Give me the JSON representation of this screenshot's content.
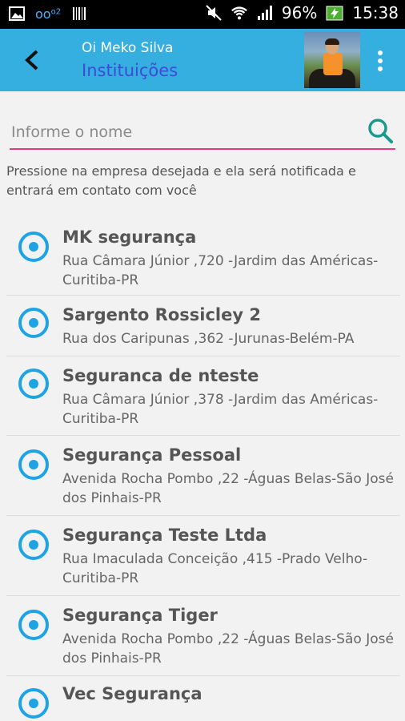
{
  "status_bar": {
    "battery": "96%",
    "time": "15:38",
    "carrier_label": "o2"
  },
  "app_bar": {
    "greeting": "Oi Meko Silva",
    "title": "Instituições"
  },
  "search": {
    "placeholder": "Informe o nome",
    "value": ""
  },
  "hint": "Pressione na empresa desejada e ela será notificada e entrará em contato com você",
  "companies": [
    {
      "name": "MK segurança",
      "address": "Rua Câmara Júnior ,720 -Jardim das Américas-Curitiba-PR"
    },
    {
      "name": "Sargento Rossicley 2",
      "address": "Rua dos Caripunas ,362 -Jurunas-Belém-PA"
    },
    {
      "name": "Seguranca de nteste",
      "address": "Rua Câmara Júnior ,378 -Jardim das Américas-Curitiba-PR"
    },
    {
      "name": "Segurança Pessoal",
      "address": "Avenida Rocha Pombo ,22 -Águas Belas-São José dos Pinhais-PR"
    },
    {
      "name": "Segurança Teste Ltda",
      "address": "Rua Imaculada Conceição ,415 -Prado Velho-Curitiba-PR"
    },
    {
      "name": "Segurança Tiger",
      "address": "Avenida Rocha Pombo ,22 -Águas Belas-São José dos Pinhais-PR"
    },
    {
      "name": "Vec Segurança",
      "address": ""
    }
  ],
  "colors": {
    "app_bar": "#35aee0",
    "accent": "#e23e7b",
    "radio": "#1ea4e3",
    "search_icon": "#1a9a8c"
  }
}
